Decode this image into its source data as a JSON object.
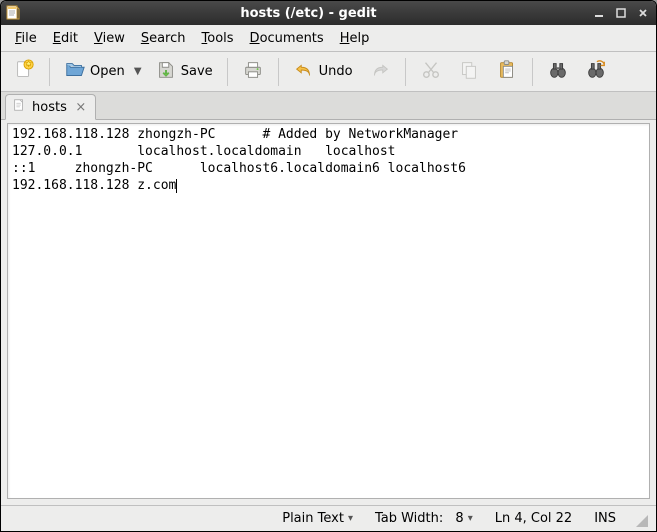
{
  "window": {
    "title": "hosts (/etc) - gedit"
  },
  "menu": {
    "file": "File",
    "edit": "Edit",
    "view": "View",
    "search": "Search",
    "tools": "Tools",
    "documents": "Documents",
    "help": "Help"
  },
  "toolbar": {
    "open": "Open",
    "save": "Save",
    "undo": "Undo"
  },
  "tab": {
    "label": "hosts"
  },
  "editor": {
    "content": "192.168.118.128 zhongzh-PC      # Added by NetworkManager\n127.0.0.1       localhost.localdomain   localhost\n::1     zhongzh-PC      localhost6.localdomain6 localhost6\n192.168.118.128 z.com"
  },
  "status": {
    "highlight": "Plain Text",
    "tabwidth_label": "Tab Width:",
    "tabwidth_value": "8",
    "position": "Ln 4, Col 22",
    "insert_mode": "INS"
  }
}
